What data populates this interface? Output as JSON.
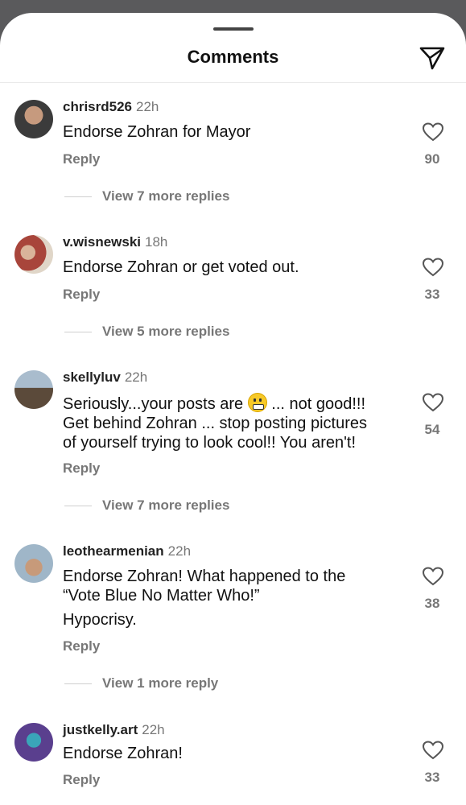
{
  "header": {
    "title": "Comments"
  },
  "comments": [
    {
      "username": "chrisrd526",
      "time": "22h",
      "lines": [
        "Endorse Zohran for Mayor"
      ],
      "reply_label": "Reply",
      "likes": "90",
      "view_replies": "View 7 more replies",
      "avatar_colors": [
        "#3b3b3b",
        "#c69a7e"
      ]
    },
    {
      "username": "v.wisnewski",
      "time": "18h",
      "lines": [
        "Endorse Zohran or get voted out."
      ],
      "reply_label": "Reply",
      "likes": "33",
      "view_replies": "View 5 more replies",
      "avatar_colors": [
        "#a8453b",
        "#d9b49a"
      ]
    },
    {
      "username": "skellyluv",
      "time": "22h",
      "lines": [
        "Seriously...your posts are",
        "... not good!!!",
        "Get behind Zohran ... stop posting pictures",
        "of yourself trying to look cool!! You aren't!"
      ],
      "reply_label": "Reply",
      "likes": "54",
      "view_replies": "View 7 more replies",
      "avatar_colors": [
        "#8ea1b5",
        "#5b4a3a"
      ]
    },
    {
      "username": "leothearmenian",
      "time": "22h",
      "lines": [
        "Endorse Zohran! What happened to the",
        "“Vote Blue No Matter Who!”",
        "Hypocrisy."
      ],
      "reply_label": "Reply",
      "likes": "38",
      "view_replies": "View 1 more reply",
      "avatar_colors": [
        "#9fb6c8",
        "#c79a7a"
      ]
    },
    {
      "username": "justkelly.art",
      "time": "22h",
      "lines": [
        "Endorse Zohran!"
      ],
      "reply_label": "Reply",
      "likes": "33",
      "view_replies": "",
      "avatar_colors": [
        "#5a3f8e",
        "#3aa6b9"
      ]
    }
  ],
  "icons": {
    "share": "paper-plane-icon",
    "like": "heart-outline-icon",
    "emoji": "grimacing-face-emoji"
  }
}
